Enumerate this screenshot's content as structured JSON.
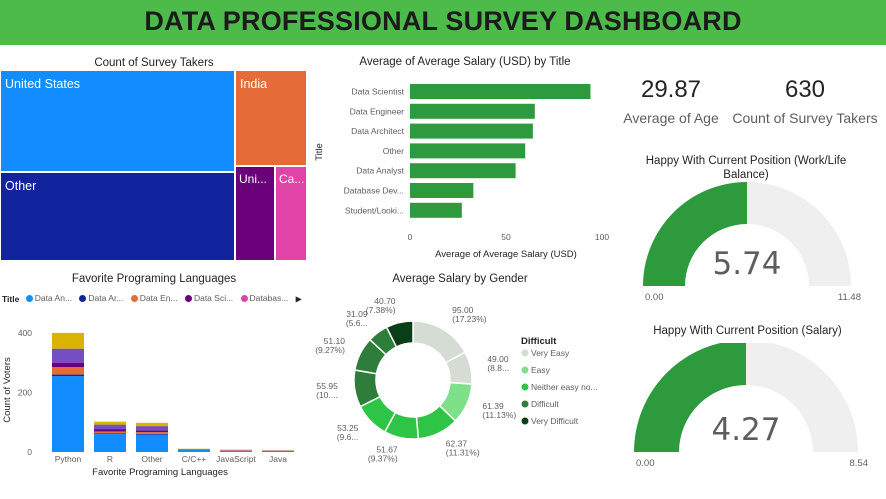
{
  "header": {
    "title": "DATA PROFESSIONAL SURVEY DASHBOARD"
  },
  "colors": {
    "header_bg": "#4cbb4a",
    "gauge_fill": "#2e9a3e",
    "gauge_track": "#efefef",
    "bar_green": "#2e9a3e"
  },
  "kpis": [
    {
      "value": "29.87",
      "label": "Average of Age"
    },
    {
      "value": "630",
      "label": "Count of Survey Takers"
    }
  ],
  "chart_data": [
    {
      "type": "treemap",
      "title": "Count of Survey Takers",
      "items": [
        {
          "label": "United States",
          "color": "#118dff"
        },
        {
          "label": "Other",
          "color": "#12239e"
        },
        {
          "label": "India",
          "color": "#e66c37"
        },
        {
          "label": "Uni...",
          "color": "#6b007b"
        },
        {
          "label": "Ca...",
          "color": "#e044a7"
        }
      ]
    },
    {
      "type": "bar",
      "orientation": "horizontal",
      "title": "Average of Average Salary (USD) by Title",
      "categories": [
        "Data Scientist",
        "Data Engineer",
        "Data Architect",
        "Other",
        "Data Analyst",
        "Database Dev...",
        "Student/Looki..."
      ],
      "values": [
        94,
        65,
        64,
        60,
        55,
        33,
        27
      ],
      "xlabel": "Average of Average Salary (USD)",
      "ylabel": "Title",
      "xlim": [
        0,
        100
      ],
      "xticks": [
        "0",
        "50",
        "100"
      ],
      "color": "#2e9a3e"
    },
    {
      "type": "bar",
      "stacked": true,
      "title": "Favorite Programing Languages",
      "legend_title": "Title",
      "legend_more": "▶",
      "categories": [
        "Python",
        "R",
        "Other",
        "C/C++",
        "JavaScript",
        "Java"
      ],
      "series": [
        {
          "name": "Data An...",
          "color": "#118dff",
          "values": [
            255,
            60,
            58,
            7,
            3,
            2
          ]
        },
        {
          "name": "Data Ar...",
          "color": "#12239e",
          "values": [
            5,
            3,
            3,
            1,
            1,
            1
          ]
        },
        {
          "name": "Data En...",
          "color": "#e66c37",
          "values": [
            25,
            6,
            6,
            1,
            2,
            1
          ]
        },
        {
          "name": "Data Sci...",
          "color": "#6b007b",
          "values": [
            15,
            8,
            5,
            0,
            0,
            0
          ]
        },
        {
          "name": "Databas...",
          "color": "#e044a7",
          "values": [
            0,
            0,
            0,
            0,
            0,
            0
          ]
        },
        {
          "name": "",
          "color": "#744ec2",
          "values": [
            47,
            15,
            15,
            1,
            1,
            1
          ]
        },
        {
          "name": "",
          "color": "#d9b300",
          "values": [
            53,
            10,
            11,
            1,
            1,
            1
          ]
        }
      ],
      "xlabel": "Favorite Programing Languages",
      "ylabel": "Count of Voters",
      "ylim": [
        0,
        450
      ],
      "yticks": [
        "0",
        "200",
        "400"
      ]
    },
    {
      "type": "donut",
      "title": "Average Salary by Gender",
      "legend_title": "Difficult",
      "legend": [
        {
          "name": "Very Easy",
          "color": "#d5dcd4"
        },
        {
          "name": "Easy",
          "color": "#7fe08a"
        },
        {
          "name": "Neither easy no...",
          "color": "#2ec445"
        },
        {
          "name": "Difficult",
          "color": "#2f7d3b"
        },
        {
          "name": "Very Difficult",
          "color": "#0b3d17"
        }
      ],
      "slices": [
        {
          "value": 95.0,
          "label": "95.00 (17.23%)",
          "color": "#d5dcd4"
        },
        {
          "value": 49.0,
          "label": "49.00 (8.8...",
          "color": "#d5dcd4"
        },
        {
          "value": 61.39,
          "label": "61.39 (11.13%)",
          "color": "#7fe08a"
        },
        {
          "value": 62.37,
          "label": "62.37 (11.31%)",
          "color": "#2ec445"
        },
        {
          "value": 51.67,
          "label": "51.67 (9.37%)",
          "color": "#2ec445"
        },
        {
          "value": 53.25,
          "label": "53.25 (9.6...",
          "color": "#2ec445"
        },
        {
          "value": 55.95,
          "label": "55.95 (10....",
          "color": "#2f7d3b"
        },
        {
          "value": 51.1,
          "label": "51.10 (9.27%)",
          "color": "#2f7d3b"
        },
        {
          "value": 31.09,
          "label": "31.09 (5.6...",
          "color": "#2f7d3b"
        },
        {
          "value": 40.7,
          "label": "40.70 (7.38%)",
          "color": "#0b3d17"
        }
      ]
    },
    {
      "type": "gauge",
      "title": "Happy With Current Position (Work/Life Balance)",
      "value": 5.74,
      "display": "5.74",
      "min": 0,
      "max": 11.48,
      "min_label": "0.00",
      "max_label": "11.48"
    },
    {
      "type": "gauge",
      "title": "Happy With Current Position (Salary)",
      "value": 4.27,
      "display": "4.27",
      "min": 0,
      "max": 8.54,
      "min_label": "0.00",
      "max_label": "8.54"
    }
  ]
}
